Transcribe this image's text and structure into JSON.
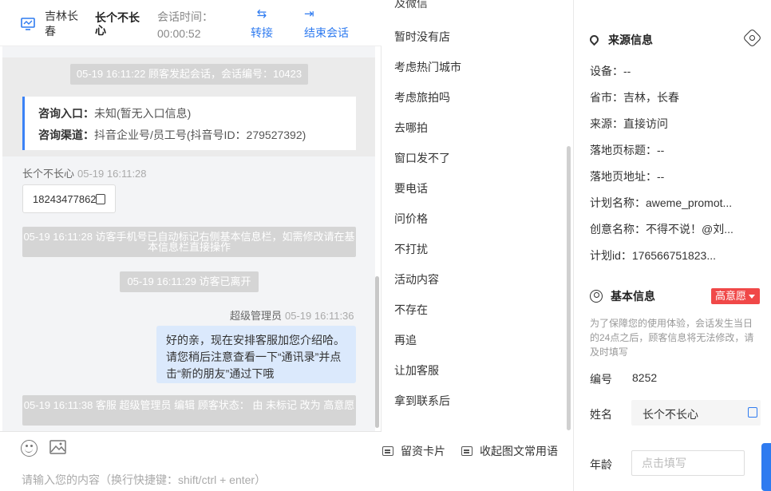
{
  "header": {
    "customer_city": "吉林长春",
    "customer_nickname": "长个不长心",
    "session_time_label": "会话时间：",
    "session_time_value": "00:00:52",
    "transfer_label": "转接",
    "end_session_label": "结束会话"
  },
  "chat": {
    "system_messages": [
      "05-19 16:11:22 顾客发起会话，会话编号：10423",
      "05-19 16:11:28 访客手机号已自动标记右侧基本信息栏，如需修改请在基本信息栏直接操作",
      "05-19 16:11:29 访客已离开",
      "05-19 16:11:38 客服 超级管理员 编辑 顾客状态： 由 未标记 改为 高意愿"
    ],
    "consult_entry_label": "咨询入口：",
    "consult_entry_value": "未知(暂无入口信息)",
    "consult_channel_label": "咨询渠道：",
    "consult_channel_value": "抖音企业号/员工号(抖音号ID：279527392)",
    "customer_sender": "长个不长心",
    "customer_time": "05-19 16:11:28",
    "customer_message": "18243477862",
    "agent_sender": "超级管理员",
    "agent_time": "05-19 16:11:36",
    "agent_message": "好的亲，现在安排客服加您介绍哈。请您稍后注意查看一下“通讯录”并点击“新的朋友”通过下哦",
    "input_placeholder": "请输入您的内容（换行快捷键：shift/ctrl + enter）"
  },
  "quick_replies": {
    "items": [
      "暂时没有店",
      "考虑热门城市",
      "考虑旅拍吗",
      "去哪拍",
      "窗口发不了",
      "要电话",
      "问价格",
      "不打扰",
      "活动内容",
      "不存在",
      "再追",
      "让加客服",
      "拿到联系后"
    ],
    "leave_card_label": "留资卡片",
    "favorite_label": "收起图文常用语"
  },
  "panel": {
    "source_title": "来源信息",
    "source_rows": [
      "设备：--",
      "省市：吉林，长春",
      "来源：直接访问",
      "落地页标题：--",
      "落地页地址：--",
      "计划名称：aweme_promot...",
      "创意名称：不得不说！@刘...",
      "计划id：176566751823..."
    ],
    "basic_title": "基本信息",
    "intent_badge": "高意愿",
    "notice": "为了保障您的使用体验，会话发生当日的24点之后，顾客信息将无法修改，请及时填写",
    "id_label": "编号",
    "id_value": "8252",
    "name_label": "姓名",
    "name_value": "长个不长心",
    "age_label": "年龄",
    "age_placeholder": "点击填写"
  }
}
